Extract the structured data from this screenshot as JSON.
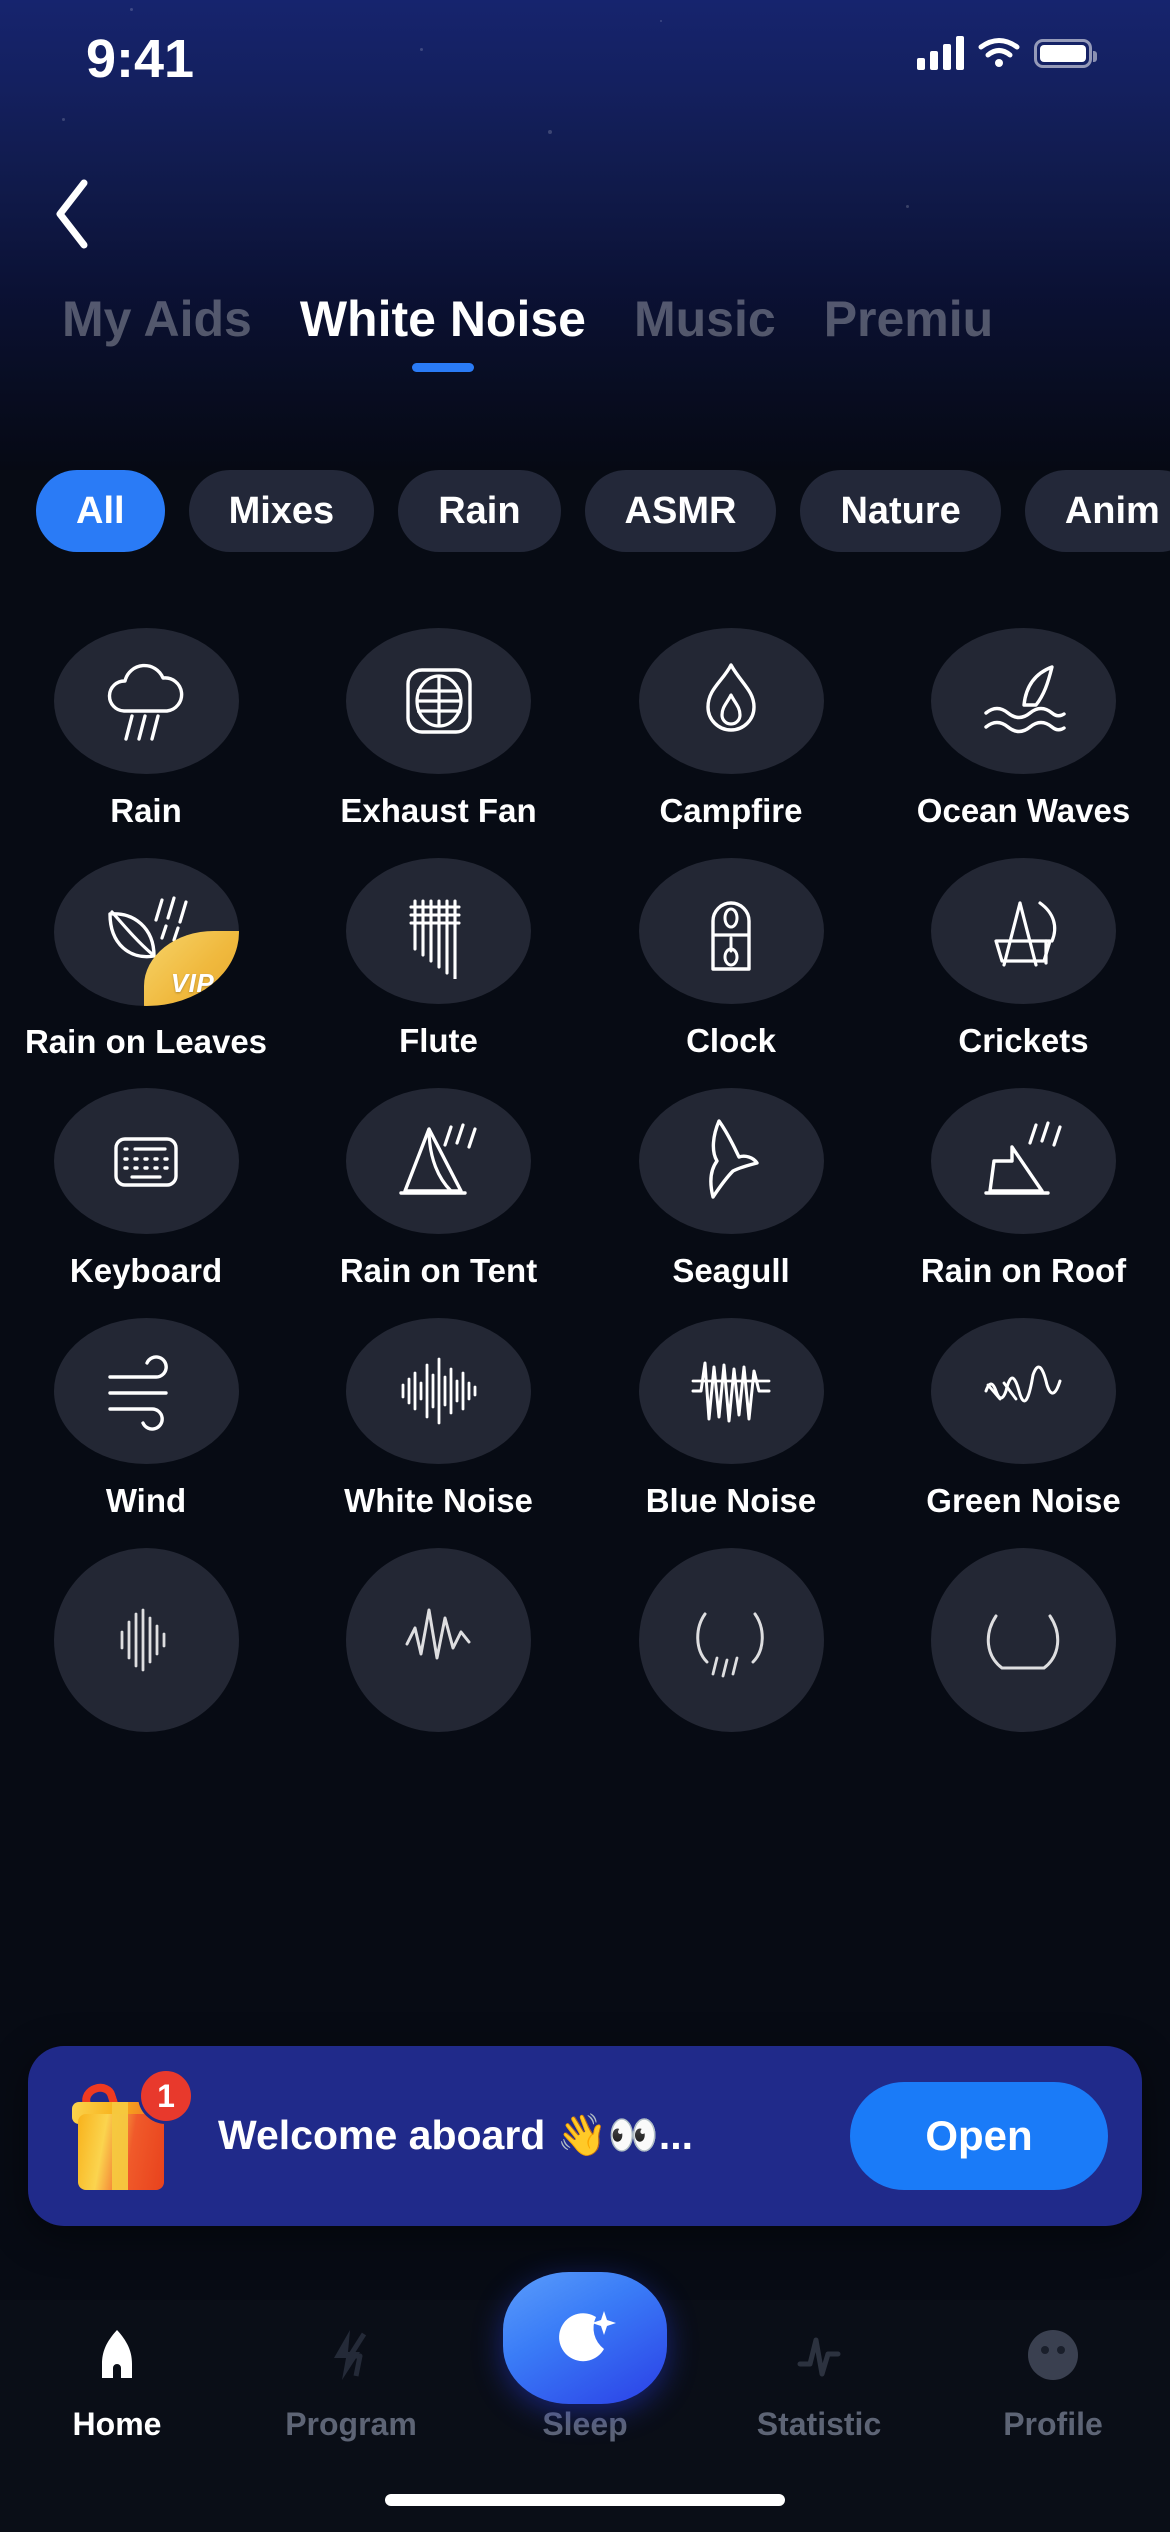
{
  "status_bar": {
    "time": "9:41",
    "signal_icon": "cellular-bars-icon",
    "wifi_icon": "wifi-icon",
    "battery_icon": "battery-icon"
  },
  "header": {
    "back_icon": "chevron-left-icon",
    "tabs": [
      {
        "label": "My Aids",
        "active": false
      },
      {
        "label": "White Noise",
        "active": true
      },
      {
        "label": "Music",
        "active": false
      },
      {
        "label": "Premiu",
        "active": false
      }
    ]
  },
  "categories": {
    "items": [
      {
        "label": "All",
        "active": true
      },
      {
        "label": "Mixes",
        "active": false
      },
      {
        "label": "Rain",
        "active": false
      },
      {
        "label": "ASMR",
        "active": false
      },
      {
        "label": "Nature",
        "active": false
      },
      {
        "label": "Anim",
        "active": false
      }
    ]
  },
  "sounds": [
    {
      "label": "Rain",
      "icon": "rain-cloud-icon",
      "vip": false
    },
    {
      "label": "Exhaust Fan",
      "icon": "exhaust-fan-icon",
      "vip": false
    },
    {
      "label": "Campfire",
      "icon": "flame-icon",
      "vip": false
    },
    {
      "label": "Ocean Waves",
      "icon": "ocean-wave-icon",
      "vip": false
    },
    {
      "label": "Rain on Leaves",
      "icon": "leaf-rain-icon",
      "vip": true,
      "vip_label": "VIP"
    },
    {
      "label": "Flute",
      "icon": "pan-flute-icon",
      "vip": false
    },
    {
      "label": "Clock",
      "icon": "pendulum-clock-icon",
      "vip": false
    },
    {
      "label": "Crickets",
      "icon": "cricket-icon",
      "vip": false
    },
    {
      "label": "Keyboard",
      "icon": "keyboard-icon",
      "vip": false
    },
    {
      "label": "Rain on Tent",
      "icon": "tent-rain-icon",
      "vip": false
    },
    {
      "label": "Seagull",
      "icon": "seagull-icon",
      "vip": false
    },
    {
      "label": "Rain on Roof",
      "icon": "roof-rain-icon",
      "vip": false
    },
    {
      "label": "Wind",
      "icon": "wind-icon",
      "vip": false
    },
    {
      "label": "White Noise",
      "icon": "white-noise-wave-icon",
      "vip": false
    },
    {
      "label": "Blue Noise",
      "icon": "blue-noise-wave-icon",
      "vip": false
    },
    {
      "label": "Green Noise",
      "icon": "green-noise-wave-icon",
      "vip": false
    },
    {
      "label": "",
      "icon": "sound-wave-bars-icon",
      "vip": false
    },
    {
      "label": "",
      "icon": "zigzag-wave-icon",
      "vip": false
    },
    {
      "label": "",
      "icon": "bowl-icon",
      "vip": false
    },
    {
      "label": "",
      "icon": "arc-icon",
      "vip": false
    }
  ],
  "toast": {
    "gift_icon": "gift-box-icon",
    "badge_count": "1",
    "message": "Welcome aboard 👋👀...",
    "open_label": "Open"
  },
  "bottom_nav": {
    "items": [
      {
        "label": "Home",
        "icon": "home-icon",
        "active": true
      },
      {
        "label": "Program",
        "icon": "lightning-icon",
        "active": false
      },
      {
        "label": "Sleep",
        "icon": "moon-star-icon",
        "active": false
      },
      {
        "label": "Statistic",
        "icon": "pulse-icon",
        "active": false
      },
      {
        "label": "Profile",
        "icon": "profile-avatar-icon",
        "active": false
      }
    ]
  },
  "colors": {
    "accent_blue": "#2a7bf6",
    "chip_inactive": "#232839",
    "disc_bg": "#232734",
    "vip_gold": "#f0b93e",
    "toast_bg": "#202a8a",
    "background": "#070b14"
  }
}
